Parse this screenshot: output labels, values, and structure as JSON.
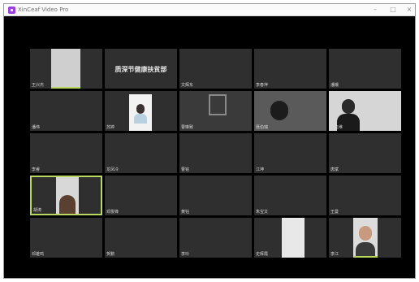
{
  "window": {
    "title": "XinCeaf Video Pro"
  },
  "controls": {
    "minimize": "–",
    "maximize": "□",
    "close": "×"
  },
  "grid": {
    "center_label": "质深节健康扶贫部",
    "tiles": [
      {
        "name": "王兴杰"
      },
      {
        "name": ""
      },
      {
        "name": "文辉东"
      },
      {
        "name": "李春萍"
      },
      {
        "name": "潘娥"
      },
      {
        "name": "潘伟"
      },
      {
        "name": "苏婷"
      },
      {
        "name": "曹琳致"
      },
      {
        "name": "聂伯瑞"
      },
      {
        "name": "黄玉维"
      },
      {
        "name": "李睿"
      },
      {
        "name": "龙凤冷"
      },
      {
        "name": "曹铭"
      },
      {
        "name": "江坤"
      },
      {
        "name": "唐斌"
      },
      {
        "name": "胡涛"
      },
      {
        "name": "邓俊锋"
      },
      {
        "name": "黄钰"
      },
      {
        "name": "朱宝文"
      },
      {
        "name": "王曼"
      },
      {
        "name": "邓雄鸣"
      },
      {
        "name": "贺鹏"
      },
      {
        "name": "李玲"
      },
      {
        "name": "史辉霞"
      },
      {
        "name": "李江"
      }
    ]
  }
}
